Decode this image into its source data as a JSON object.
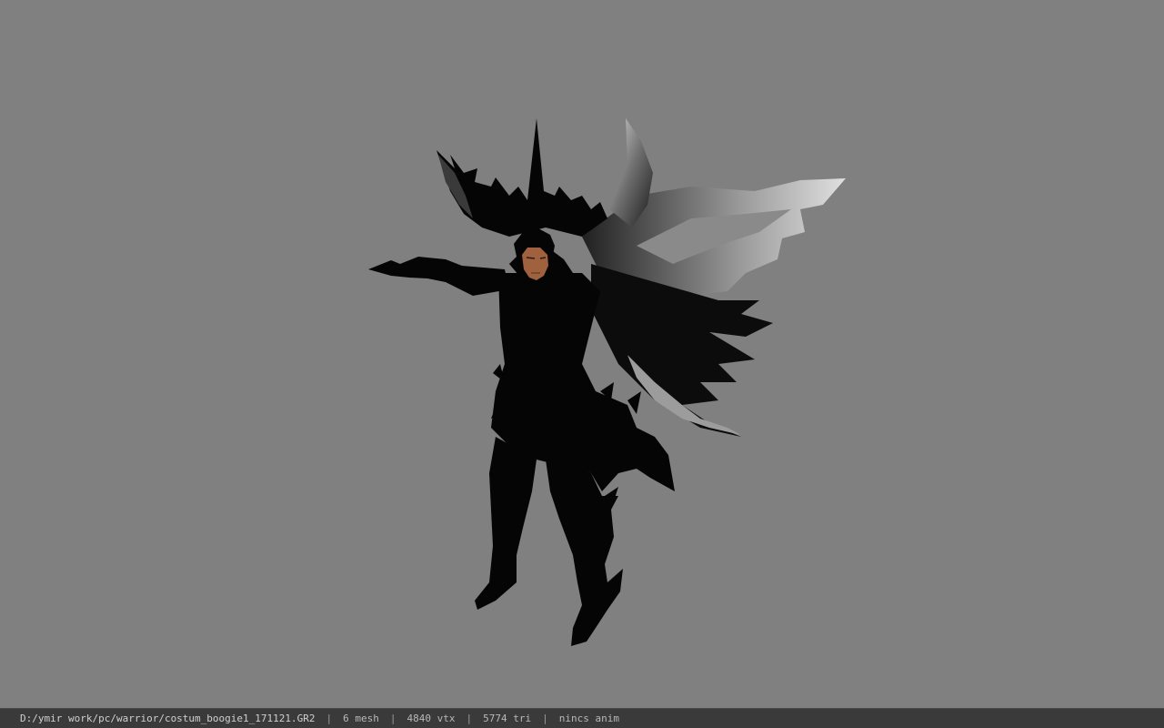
{
  "viewer": {
    "background_color": "#808080",
    "model_subject": "dark winged warrior costume model",
    "model_colors": {
      "armor": "#050505",
      "wing_highlight": "#bdbdbd",
      "skin": "#a0613e"
    }
  },
  "status_bar": {
    "file_path": "D:/ymir work/pc/warrior/costum_boogie1_171121.GR2",
    "separator": "|",
    "mesh_count": "6 mesh",
    "vertex_count": "4840 vtx",
    "triangle_count": "5774 tri",
    "animation": "nincs anim"
  }
}
